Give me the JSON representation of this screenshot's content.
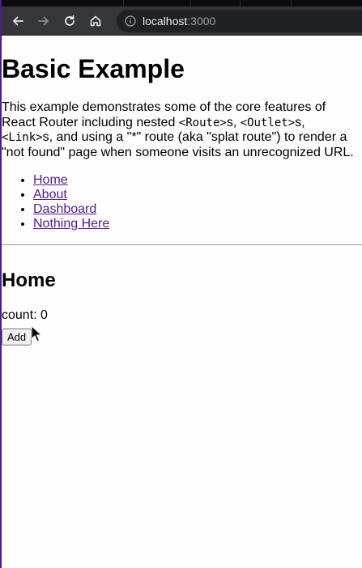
{
  "browser": {
    "url_host": "localhost",
    "url_port": ":3000",
    "icons": [
      "back-arrow-icon",
      "forward-arrow-icon",
      "reload-icon",
      "home-icon",
      "info-icon"
    ]
  },
  "page": {
    "title": "Basic Example",
    "intro": {
      "t1": "This example demonstrates some of the core features of",
      "t2": "React Router including nested ",
      "c1": "<Route>",
      "t3": "s, ",
      "c2": "<Outlet>",
      "t4": "s,",
      "c3": "<Link>",
      "t5": "s, and using a \"*\" route (aka \"splat route\") to render a",
      "t6": "\"not found\" page when someone visits an unrecognized URL."
    },
    "nav": [
      {
        "label": "Home"
      },
      {
        "label": "About"
      },
      {
        "label": "Dashboard"
      },
      {
        "label": "Nothing Here"
      }
    ],
    "section_title": "Home",
    "count_label": "count: 0",
    "add_button": "Add"
  },
  "colors": {
    "link": "#551a8b",
    "toolbar": "#35363a",
    "omnibox": "#202124"
  }
}
